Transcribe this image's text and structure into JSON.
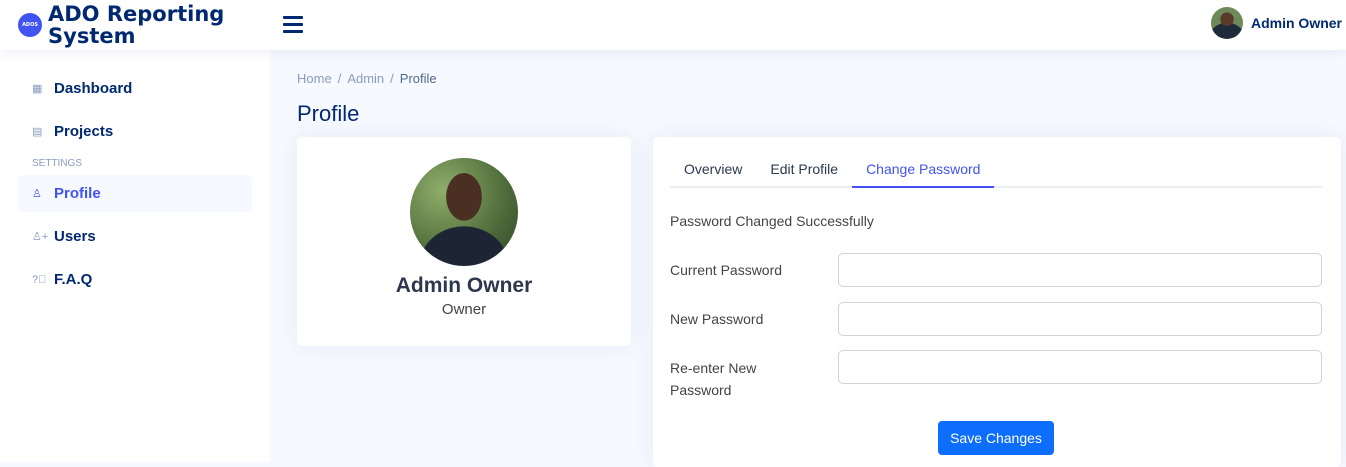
{
  "app": {
    "logo_badge": "ADOS",
    "title": "ADO Reporting System"
  },
  "header": {
    "user_name": "Admin Owner"
  },
  "sidebar": {
    "items": [
      {
        "label": "Dashboard",
        "icon": "grid-icon"
      },
      {
        "label": "Projects",
        "icon": "layout-icon"
      }
    ],
    "settings_heading": "SETTINGS",
    "settings_items": [
      {
        "label": "Profile",
        "icon": "person-icon",
        "active": true
      },
      {
        "label": "Users",
        "icon": "person-add-icon"
      },
      {
        "label": "F.A.Q",
        "icon": "question-circle-icon"
      }
    ]
  },
  "breadcrumb": {
    "items": [
      "Home",
      "Admin",
      "Profile"
    ]
  },
  "page": {
    "title": "Profile"
  },
  "profile": {
    "name": "Admin Owner",
    "role": "Owner"
  },
  "tabs": [
    {
      "label": "Overview"
    },
    {
      "label": "Edit Profile"
    },
    {
      "label": "Change Password",
      "active": true
    }
  ],
  "form": {
    "success_message": "Password Changed Successfully",
    "current_password_label": "Current Password",
    "current_password_value": "",
    "new_password_label": "New Password",
    "new_password_value": "",
    "renew_password_label": "Re-enter New Password",
    "renew_password_value": "",
    "save_label": "Save Changes"
  },
  "colors": {
    "brand": "#012970",
    "accent": "#4154f1",
    "button": "#0d6efd",
    "background": "#f6f9ff"
  }
}
